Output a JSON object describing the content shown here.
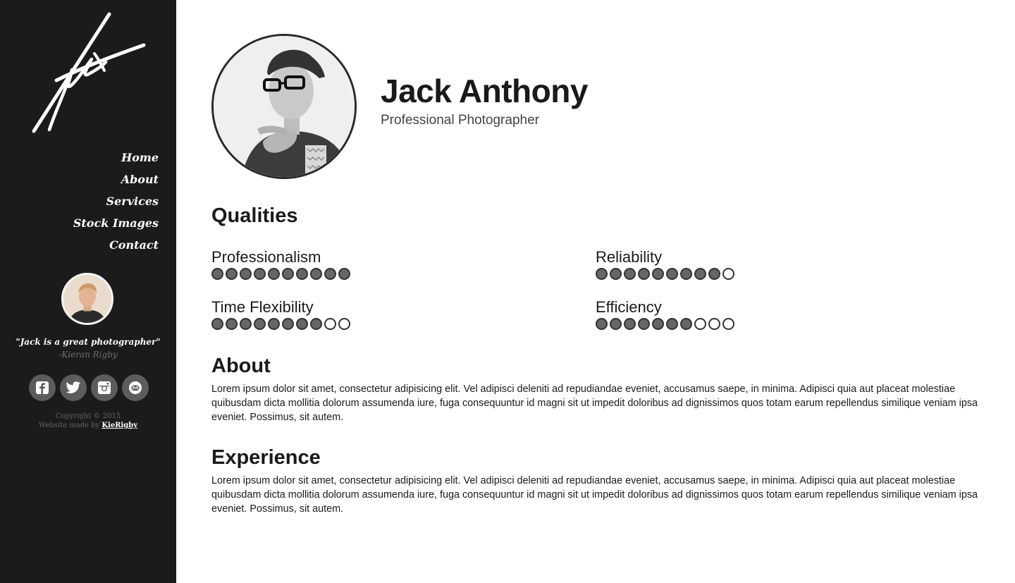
{
  "sidebar": {
    "nav": [
      {
        "label": "Home"
      },
      {
        "label": "About"
      },
      {
        "label": "Services"
      },
      {
        "label": "Stock Images"
      },
      {
        "label": "Contact"
      }
    ],
    "testimonial": {
      "quote": "\"Jack is a great photographer\"",
      "author": "-Kieran Rigby"
    },
    "socials": [
      {
        "icon": "facebook-icon"
      },
      {
        "icon": "twitter-icon"
      },
      {
        "icon": "instagram-icon"
      },
      {
        "icon": "email-icon"
      }
    ],
    "copyright": "Copyright © 2015",
    "made_by_prefix": "Website made by",
    "made_by_link": "KieRigby"
  },
  "profile": {
    "name": "Jack Anthony",
    "tagline": "Professional Photographer"
  },
  "qualities": {
    "title": "Qualities",
    "items": [
      {
        "label": "Professionalism",
        "rating": 10,
        "max": 10
      },
      {
        "label": "Reliability",
        "rating": 9,
        "max": 10
      },
      {
        "label": "Time Flexibility",
        "rating": 8,
        "max": 10
      },
      {
        "label": "Efficiency",
        "rating": 7,
        "max": 10
      }
    ]
  },
  "about": {
    "title": "About",
    "text": "Lorem ipsum dolor sit amet, consectetur adipisicing elit. Vel adipisci deleniti ad repudiandae eveniet, accusamus saepe, in minima. Adipisci quia aut placeat molestiae quibusdam dicta mollitia dolorum assumenda iure, fuga consequuntur id magni sit ut impedit doloribus ad dignissimos quos totam earum repellendus similique veniam ipsa eveniet. Possimus, sit autem."
  },
  "experience": {
    "title": "Experience",
    "text": "Lorem ipsum dolor sit amet, consectetur adipisicing elit. Vel adipisci deleniti ad repudiandae eveniet, accusamus saepe, in minima. Adipisci quia aut placeat molestiae quibusdam dicta mollitia dolorum assumenda iure, fuga consequuntur id magni sit ut impedit doloribus ad dignissimos quos totam earum repellendus similique veniam ipsa eveniet. Possimus, sit autem."
  },
  "colors": {
    "sidebar_bg": "#1b1b1b",
    "dot_filled": "#666666",
    "dot_border": "#333333",
    "social_bg": "#5c5c5c"
  }
}
